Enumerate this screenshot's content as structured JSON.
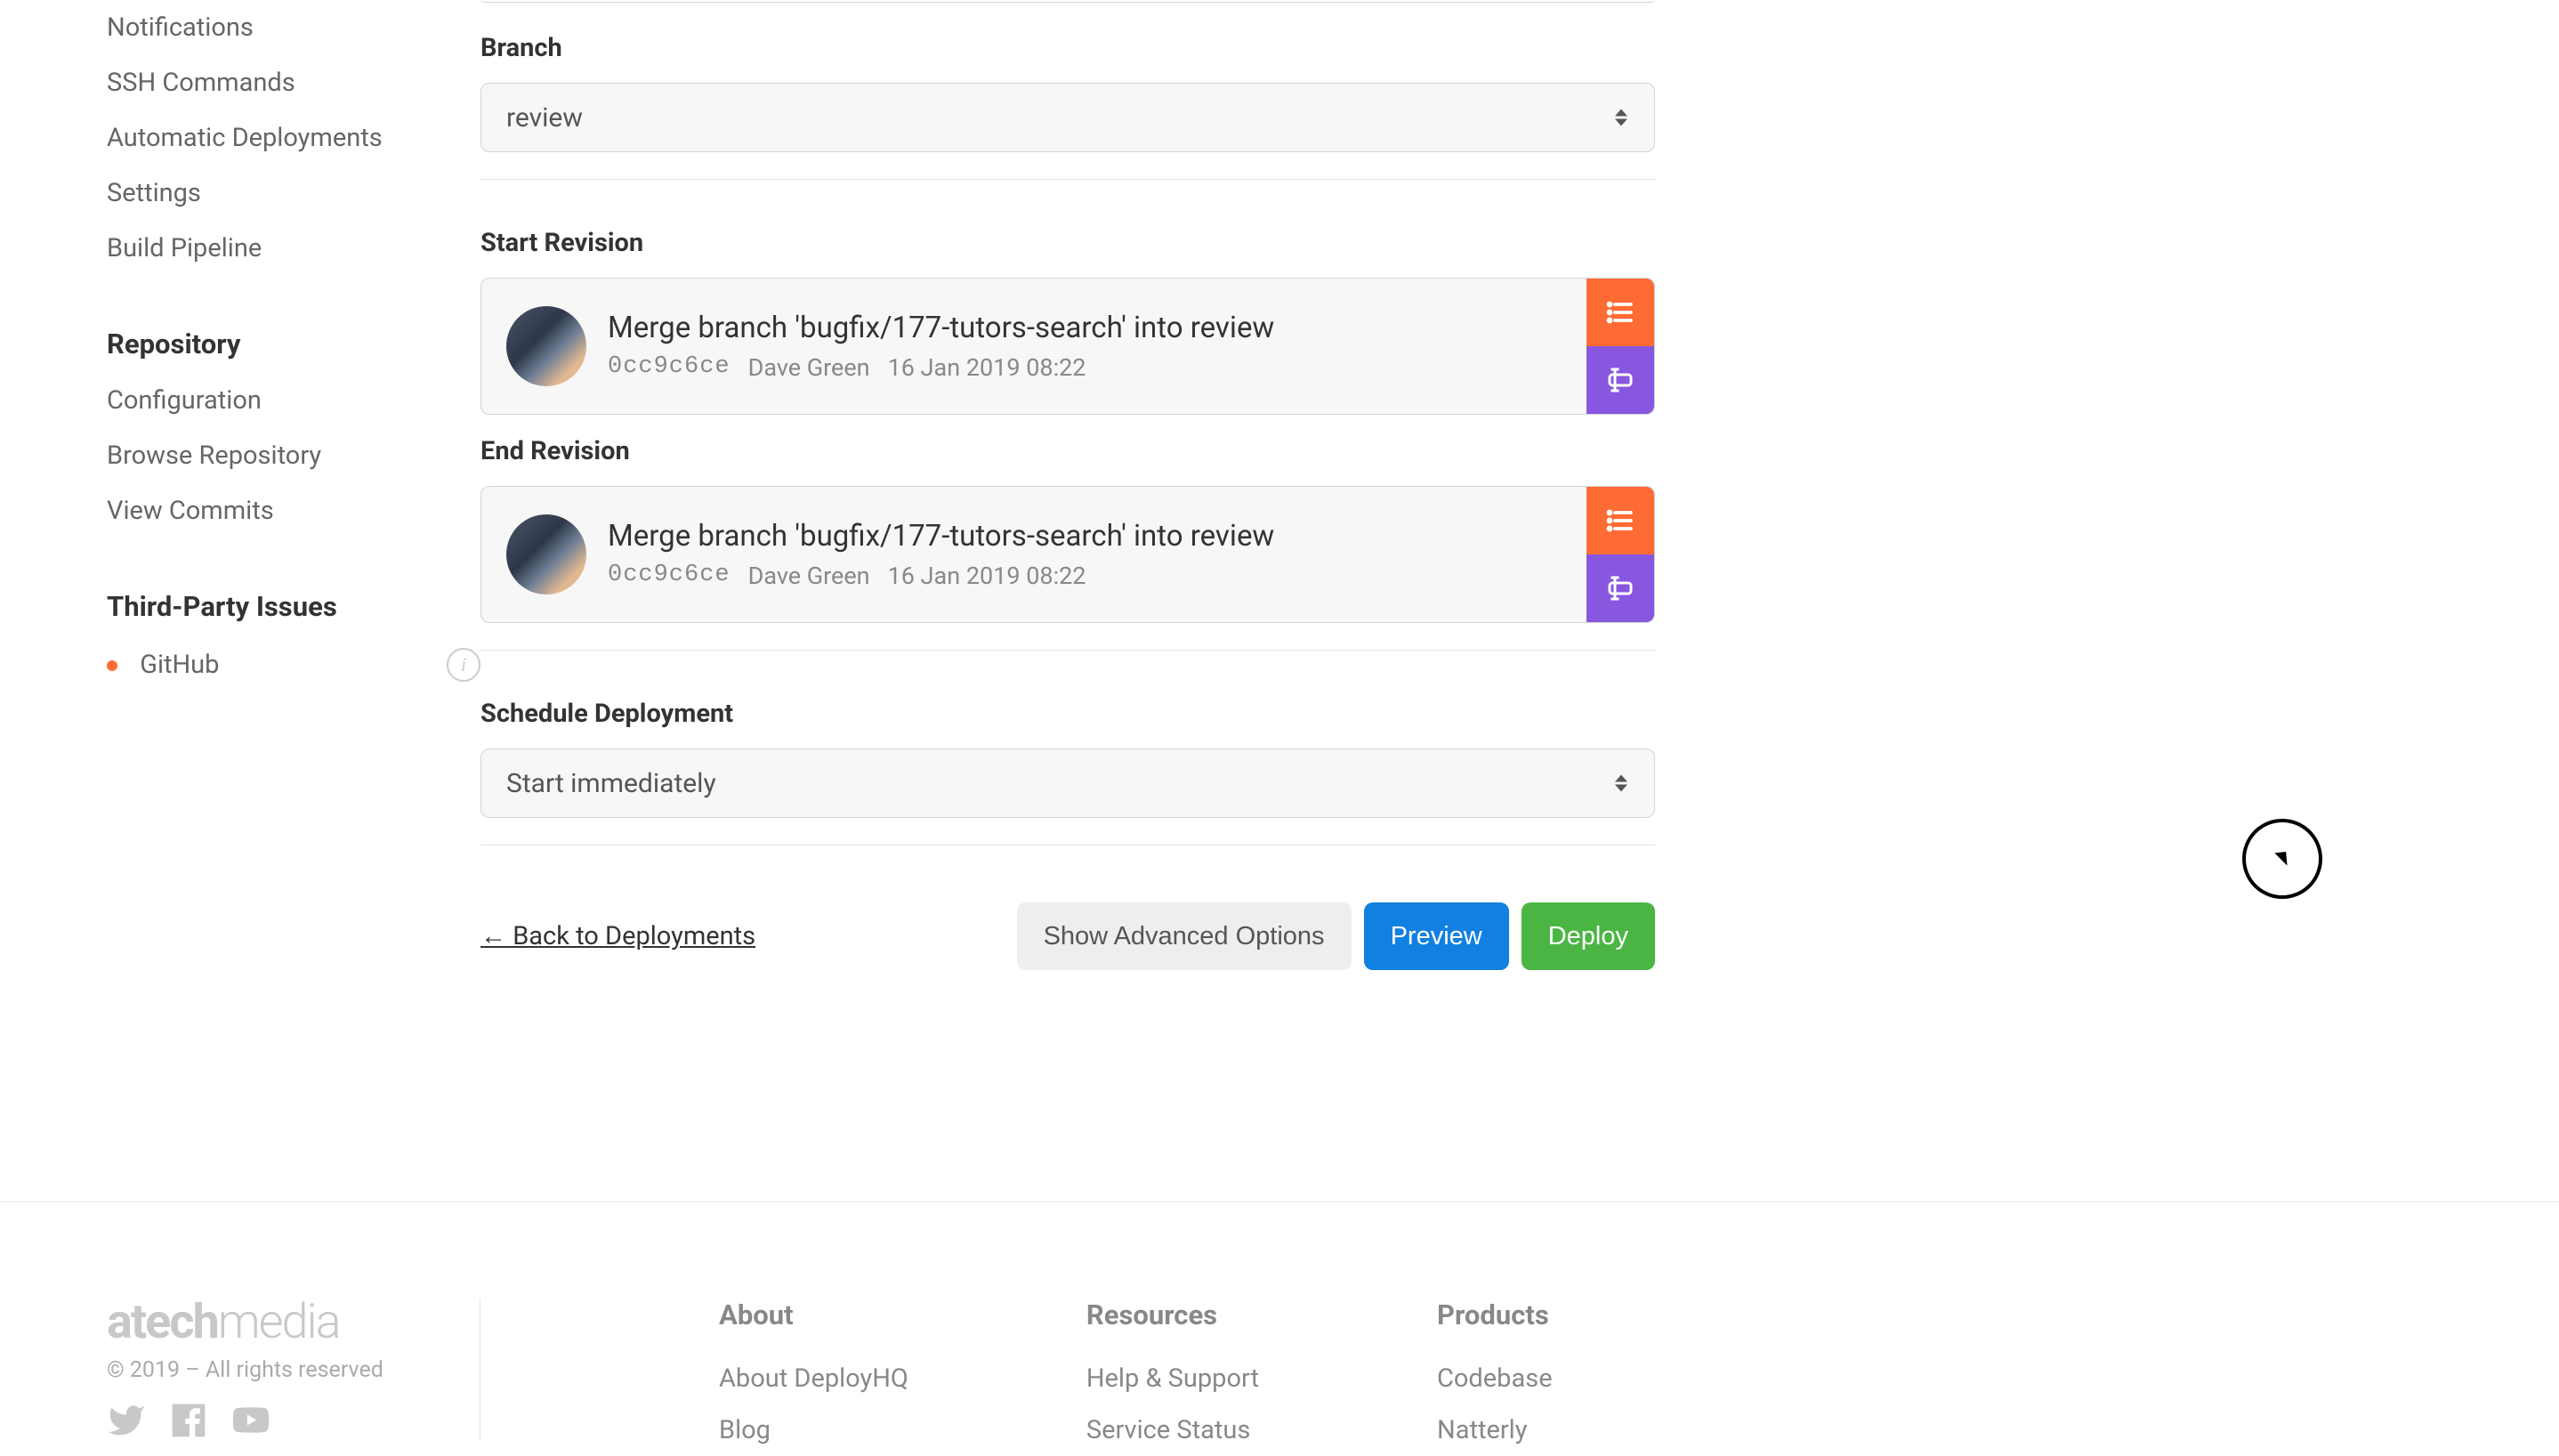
{
  "sidebar": {
    "project_items": [
      "Notifications",
      "SSH Commands",
      "Automatic Deployments",
      "Settings",
      "Build Pipeline"
    ],
    "repository_heading": "Repository",
    "repository_items": [
      "Configuration",
      "Browse Repository",
      "View Commits"
    ],
    "issues_heading": "Third-Party Issues",
    "issues_items": [
      "GitHub"
    ]
  },
  "form": {
    "branch_label": "Branch",
    "branch_value": "review",
    "start_revision_label": "Start Revision",
    "end_revision_label": "End Revision",
    "revision": {
      "message": "Merge branch 'bugfix/177-tutors-search' into review",
      "hash": "0cc9c6ce",
      "author": "Dave Green",
      "timestamp": "16 Jan 2019 08:22"
    },
    "schedule_label": "Schedule Deployment",
    "schedule_value": "Start immediately"
  },
  "actions": {
    "back_link": "← Back to Deployments",
    "advanced": "Show Advanced Options",
    "preview": "Preview",
    "deploy": "Deploy"
  },
  "footer": {
    "brand_a": "atech",
    "brand_b": "media",
    "copyright": "© 2019 – All rights reserved",
    "cols": [
      {
        "heading": "About",
        "links": [
          "About DeployHQ",
          "Blog"
        ]
      },
      {
        "heading": "Resources",
        "links": [
          "Help & Support",
          "Service Status"
        ]
      },
      {
        "heading": "Products",
        "links": [
          "Codebase",
          "Natterly"
        ]
      }
    ]
  }
}
